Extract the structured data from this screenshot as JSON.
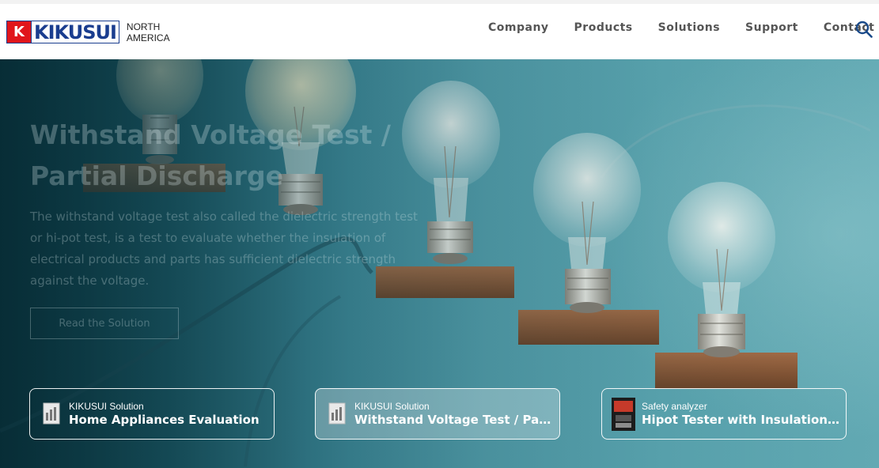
{
  "header": {
    "logo_mark": "K",
    "logo_word": "KIKUSUI",
    "logo_sub_line1": "NORTH",
    "logo_sub_line2": "AMERICA",
    "nav": [
      "Company",
      "Products",
      "Solutions",
      "Support",
      "Contact"
    ],
    "search_icon": "search-icon"
  },
  "hero": {
    "title_line1": "Withstand Voltage Test /",
    "title_line2": "Partial Discharge",
    "description": "The withstand voltage test also called the dielectric strength test or hi-pot test, is a test to evaluate whether the insulation of electrical products and parts has sufficient dielectric strength against the voltage.",
    "button_label": "Read the Solution"
  },
  "cards": [
    {
      "category": "KIKUSUI Solution",
      "title": "Home Appliances Evaluation",
      "icon": "document-icon",
      "active": false
    },
    {
      "category": "KIKUSUI Solution",
      "title": "Withstand Voltage Test / Partial Discharge",
      "icon": "document-icon",
      "active": true
    },
    {
      "category": "Safety analyzer",
      "title": "Hipot Tester with Insulation Resistance Tester",
      "icon": "product-thumbnail",
      "active": false
    }
  ],
  "colors": {
    "brand_red": "#e0151b",
    "brand_blue": "#1a3d8f",
    "nav_text": "#555555",
    "hero_teal": "#5aa6b2"
  }
}
